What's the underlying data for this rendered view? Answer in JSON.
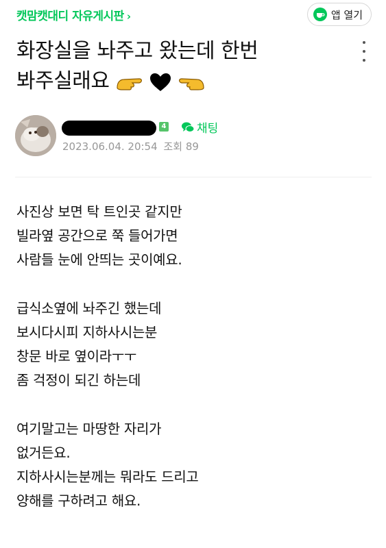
{
  "header": {
    "board_name": "캣맘캣대디 자유게시판",
    "chevron": "›",
    "app_button_label": "앱 열기",
    "app_icon": "cafe-cup-icon",
    "accent_color": "#03c75a"
  },
  "post": {
    "title_line1": "화장실을 놔주고 왔는데 한번",
    "title_line2": "봐주실래요",
    "title_emojis": [
      "hand-pointing-right-icon",
      "black-heart-icon",
      "hand-pointing-left-icon"
    ]
  },
  "author": {
    "level": "4",
    "chat_label": "채팅",
    "date": "2023.06.04. 20:54",
    "views_label": "조회",
    "views": "89"
  },
  "body": {
    "para1": [
      "사진상 보면 탁 트인곳 같지만",
      "빌라옆 공간으로 쭉 들어가면",
      "사람들 눈에 안띄는 곳이예요."
    ],
    "para2": [
      "급식소옆에 놔주긴 했는데",
      "보시다시피 지하사시는분",
      "창문 바로 옆이라ㅜㅜ",
      "좀 걱정이 되긴 하는데"
    ],
    "para3": [
      "여기말고는 마땅한 자리가",
      "없거든요.",
      "지하사시는분께는 뭐라도 드리고",
      "양해를 구하려고 해요."
    ]
  }
}
